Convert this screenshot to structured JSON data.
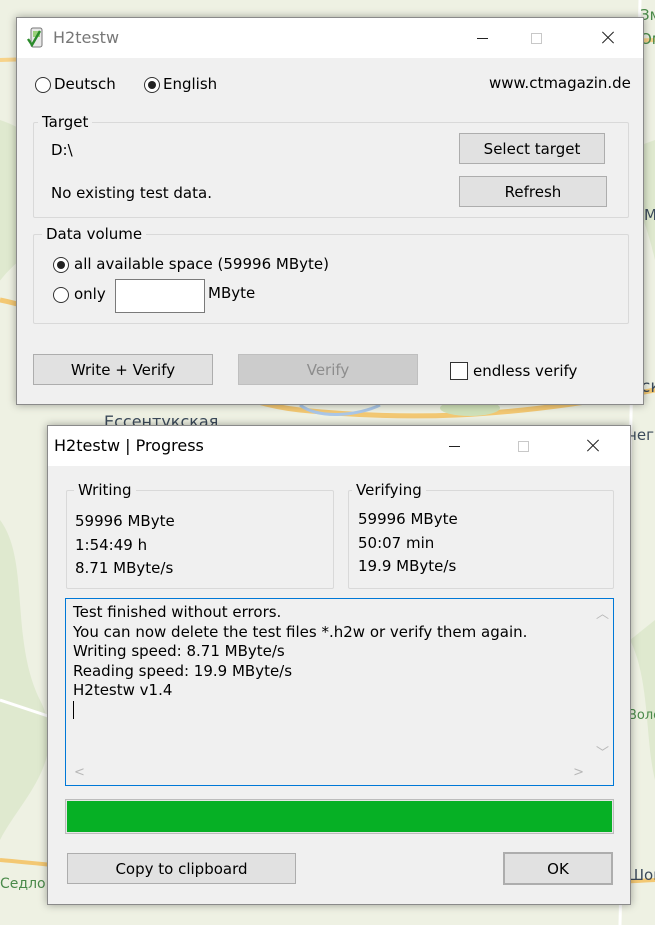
{
  "map": {
    "labels": [
      "Зм",
      "Ом",
      "М",
      "ск",
      "Ессентукская",
      "чег",
      "Волс",
      "Седло",
      "Шон"
    ]
  },
  "main_window": {
    "title": "H2testw",
    "languages": [
      {
        "label": "Deutsch",
        "selected": false
      },
      {
        "label": "English",
        "selected": true
      }
    ],
    "website": "www.ctmagazin.de",
    "target": {
      "legend": "Target",
      "path": "D:\\",
      "status": "No existing test data.",
      "select_button": "Select target",
      "refresh_button": "Refresh"
    },
    "data_volume": {
      "legend": "Data volume",
      "all_option": "all available space (59996 MByte)",
      "all_selected": true,
      "only_option": "only",
      "only_value": "",
      "unit": "MByte"
    },
    "write_verify_button": "Write + Verify",
    "verify_button": "Verify",
    "endless_verify_label": "endless verify",
    "endless_verify_checked": false
  },
  "progress_window": {
    "title": "H2testw | Progress",
    "writing": {
      "legend": "Writing",
      "size": "59996 MByte",
      "time": "1:54:49 h",
      "speed": "8.71 MByte/s"
    },
    "verifying": {
      "legend": "Verifying",
      "size": "59996 MByte",
      "time": "50:07 min",
      "speed": "19.9 MByte/s"
    },
    "log_lines": [
      "Test finished without errors.",
      "You can now delete the test files *.h2w or verify them again.",
      "Writing speed: 8.71 MByte/s",
      "Reading speed: 19.9 MByte/s",
      "H2testw v1.4"
    ],
    "progress": 1.0,
    "progress_color": "#06b025",
    "copy_button": "Copy to clipboard",
    "ok_button": "OK"
  }
}
